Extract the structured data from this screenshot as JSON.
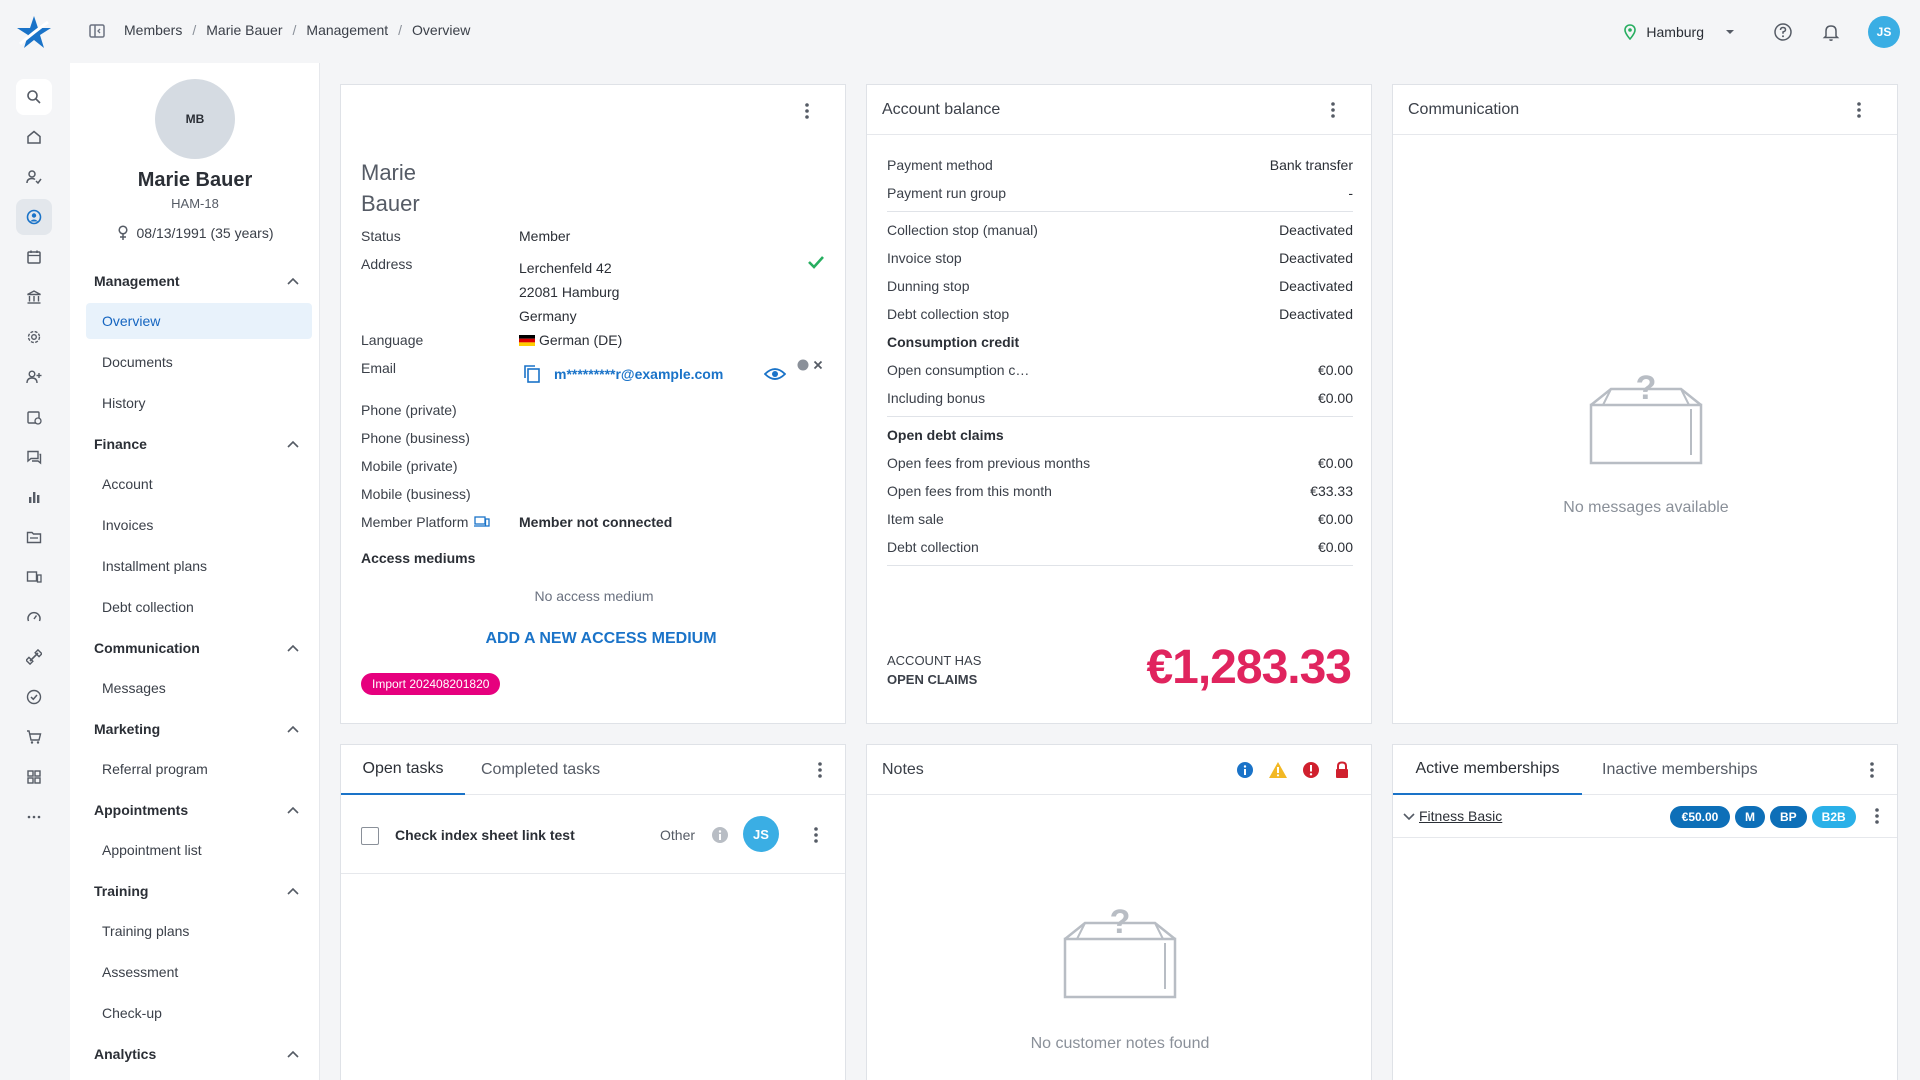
{
  "breadcrumb": [
    "Members",
    "Marie Bauer",
    "Management",
    "Overview"
  ],
  "topbar": {
    "location": "Hamburg",
    "user_initials": "JS"
  },
  "member": {
    "initials": "MB",
    "name": "Marie Bauer",
    "id": "HAM-18",
    "dob": "08/13/1991 (35 years)"
  },
  "nav": {
    "groups": [
      {
        "label": "Management",
        "items": [
          "Overview",
          "Documents",
          "History"
        ]
      },
      {
        "label": "Finance",
        "items": [
          "Account",
          "Invoices",
          "Installment plans",
          "Debt collection"
        ]
      },
      {
        "label": "Communication",
        "items": [
          "Messages"
        ]
      },
      {
        "label": "Marketing",
        "items": [
          "Referral program"
        ]
      },
      {
        "label": "Appointments",
        "items": [
          "Appointment list"
        ]
      },
      {
        "label": "Training",
        "items": [
          "Training plans",
          "Assessment",
          "Check-up"
        ]
      },
      {
        "label": "Analytics",
        "items": []
      }
    ],
    "active": "Overview"
  },
  "profile": {
    "first_name": "Marie",
    "last_name": "Bauer",
    "status_label": "Status",
    "status": "Member",
    "address_label": "Address",
    "address_line1": "Lerchenfeld 42",
    "address_line2": "22081 Hamburg",
    "address_line3": "Germany",
    "language_label": "Language",
    "language": "German (DE)",
    "email_label": "Email",
    "email": "m*********r@example.com",
    "phone_private_label": "Phone (private)",
    "phone_business_label": "Phone (business)",
    "mobile_private_label": "Mobile (private)",
    "mobile_business_label": "Mobile (business)",
    "platform_label": "Member Platform",
    "platform": "Member not connected",
    "access_label": "Access mediums",
    "no_access": "No access medium",
    "add_access": "ADD A NEW ACCESS MEDIUM",
    "import_tag": "Import 202408201820"
  },
  "balance": {
    "title": "Account balance",
    "rows": [
      {
        "label": "Payment method",
        "value": "Bank transfer"
      },
      {
        "label": "Payment run group",
        "value": "-"
      },
      {
        "label": "Collection stop (manual)",
        "value": "Deactivated"
      },
      {
        "label": "Invoice stop",
        "value": "Deactivated"
      },
      {
        "label": "Dunning stop",
        "value": "Deactivated"
      },
      {
        "label": "Debt collection stop",
        "value": "Deactivated"
      },
      {
        "label": "Consumption credit",
        "value": ""
      },
      {
        "label": "Open consumption c…",
        "value": "€0.00"
      },
      {
        "label": "Including bonus",
        "value": "€0.00"
      },
      {
        "label": "Open debt claims",
        "value": ""
      },
      {
        "label": "Open fees from previous months",
        "value": "€0.00"
      },
      {
        "label": "Open fees from this month",
        "value": "€33.33"
      },
      {
        "label": "Item sale",
        "value": "€0.00"
      },
      {
        "label": "Debt collection",
        "value": "€0.00"
      }
    ],
    "claims_line1": "ACCOUNT HAS",
    "claims_line2": "OPEN CLAIMS",
    "amount": "€1,283.33"
  },
  "communication": {
    "title": "Communication",
    "empty": "No messages available"
  },
  "tasks": {
    "tab_open": "Open tasks",
    "tab_completed": "Completed tasks",
    "items": [
      {
        "title": "Check index sheet link test",
        "category": "Other",
        "assignee": "JS"
      }
    ]
  },
  "notes": {
    "title": "Notes",
    "empty": "No customer notes found"
  },
  "memberships": {
    "tab_active": "Active memberships",
    "tab_inactive": "Inactive memberships",
    "items": [
      {
        "name": "Fitness Basic",
        "price": "€50.00",
        "tags": [
          "M",
          "BP",
          "B2B"
        ]
      }
    ]
  },
  "colors": {
    "accent": "#1a73c8",
    "claims": "#e0245e",
    "import_tag": "#e6007e",
    "check": "#27ae60"
  }
}
